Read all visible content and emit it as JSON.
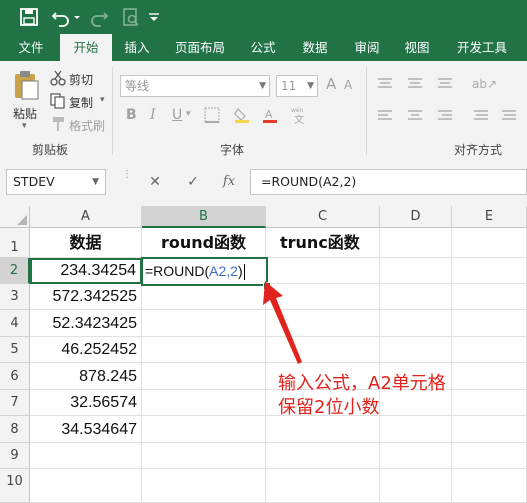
{
  "title_bar": {
    "save": "save-icon",
    "undo": "undo-icon",
    "redo": "redo-icon",
    "print_preview": "print-preview-icon"
  },
  "tabs": [
    {
      "label": "文件"
    },
    {
      "label": "开始"
    },
    {
      "label": "插入"
    },
    {
      "label": "页面布局"
    },
    {
      "label": "公式"
    },
    {
      "label": "数据"
    },
    {
      "label": "审阅"
    },
    {
      "label": "视图"
    },
    {
      "label": "开发工具"
    }
  ],
  "active_tab": "开始",
  "ribbon": {
    "clipboard": {
      "paste": "粘贴",
      "cut": "剪切",
      "copy": "复制",
      "format_painter": "格式刷",
      "label": "剪贴板"
    },
    "font": {
      "name": "等线",
      "size": "11",
      "bold": "B",
      "italic": "I",
      "underline": "U",
      "grow": "A",
      "shrink": "A",
      "label": "字体"
    },
    "alignment": {
      "label": "对齐方式"
    }
  },
  "formula_bar": {
    "name_box": "STDEV",
    "cancel": "✕",
    "enter": "✓",
    "fx": "fx",
    "formula": "=ROUND(A2,2)"
  },
  "columns": [
    "A",
    "B",
    "C",
    "D",
    "E"
  ],
  "rows": [
    "1",
    "2",
    "3",
    "4",
    "5",
    "6",
    "7",
    "8",
    "9",
    "10"
  ],
  "headers": {
    "A1": "数据",
    "B1": "round函数",
    "C1": "trunc函数"
  },
  "values": [
    "234.34254",
    "572.342525",
    "52.3423425",
    "46.252452",
    "878.245",
    "32.56574",
    "34.534647"
  ],
  "edit_cell": {
    "prefix": "=ROUND(",
    "ref": "A2,2",
    "suffix": ")"
  },
  "annotation": {
    "line1": "输入公式，A2单元格",
    "line2": "保留2位小数"
  },
  "colors": {
    "excel_green": "#217346",
    "annotation_red": "#e0231c",
    "ref_blue": "#3d6fc6"
  }
}
